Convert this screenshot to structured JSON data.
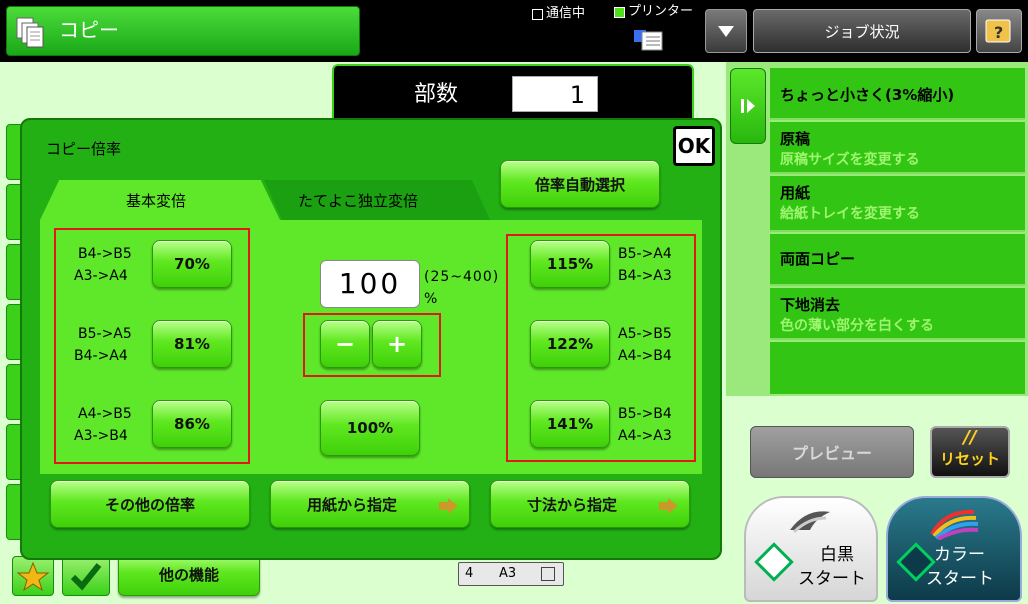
{
  "header": {
    "title": "コピー",
    "comm_label": "通信中",
    "printer_label": "プリンター",
    "job_status_label": "ジョブ状況"
  },
  "copies": {
    "label": "部数",
    "value": "1"
  },
  "dialog": {
    "title": "コピー倍率",
    "ok_label": "OK",
    "tabs": [
      "基本変倍",
      "たてよこ独立変倍"
    ],
    "auto_select_label": "倍率自動選択",
    "ratio_value": "100",
    "range_label": "(25~400)",
    "unit_label": "%",
    "minus_label": "−",
    "plus_label": "+",
    "reset_100_label": "100%",
    "reduce_presets": [
      {
        "label": "70%",
        "line1": "B4->B5",
        "line2": "A3->A4"
      },
      {
        "label": "81%",
        "line1": "B5->A5",
        "line2": "B4->A4"
      },
      {
        "label": "86%",
        "line1": "A4->B5",
        "line2": "A3->B4"
      }
    ],
    "enlarge_presets": [
      {
        "label": "115%",
        "line1": "B5->A4",
        "line2": "B4->A3"
      },
      {
        "label": "122%",
        "line1": "A5->B5",
        "line2": "A4->B4"
      },
      {
        "label": "141%",
        "line1": "B5->B4",
        "line2": "A4->A3"
      }
    ],
    "other_ratio_label": "その他の倍率",
    "from_paper_label": "用紙から指定",
    "from_size_label": "寸法から指定"
  },
  "right_panel": {
    "items": [
      {
        "title": "ちょっと小さく(3%縮小)",
        "sub": ""
      },
      {
        "title": "原稿",
        "sub": "原稿サイズを変更する"
      },
      {
        "title": "用紙",
        "sub": "給紙トレイを変更する"
      },
      {
        "title": "両面コピー",
        "sub": ""
      },
      {
        "title": "下地消去",
        "sub": "色の薄い部分を白くする"
      }
    ]
  },
  "preview_label": "プレビュー",
  "reset_label": "リセット",
  "bw_start": {
    "line1": "白黒",
    "line2": "スタート"
  },
  "color_start": {
    "line1": "カラー",
    "line2": "スタート"
  },
  "bottom": {
    "other_functions_label": "他の機能",
    "tray_number": "4",
    "tray_size": "A3"
  },
  "colors": {
    "accent_green": "#3fd00a",
    "panel_green": "#22b014",
    "highlight_red": "#e01818",
    "start_bw_green": "#00b050",
    "color_start_bg": "#1d5f6e"
  }
}
